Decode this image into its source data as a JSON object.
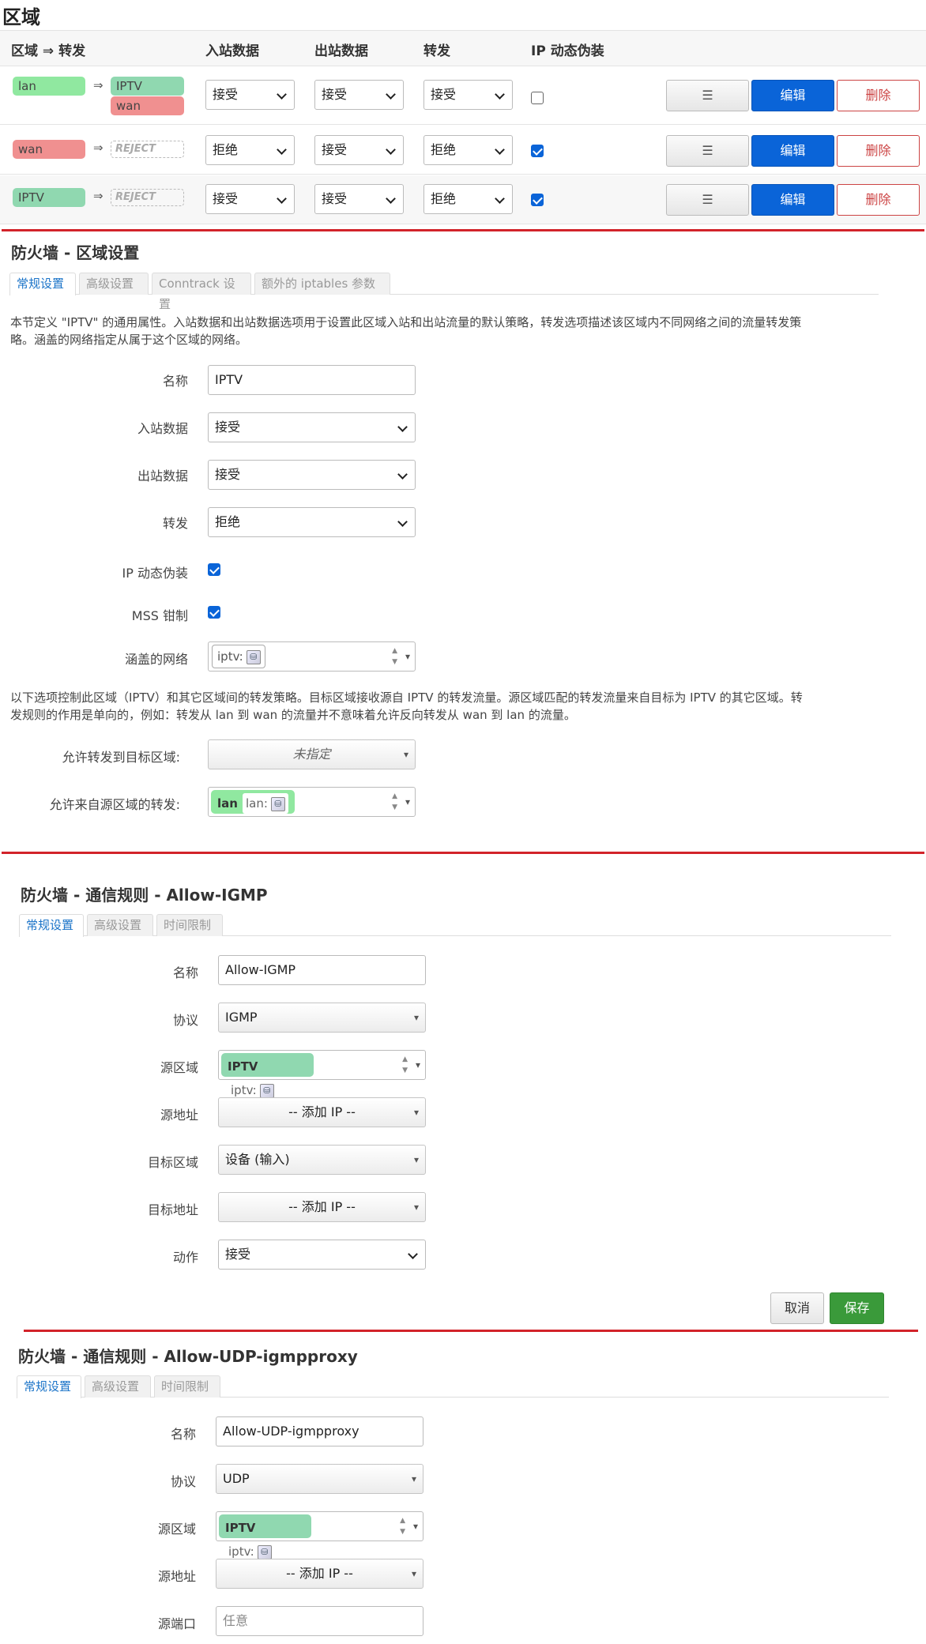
{
  "zones": {
    "title": "区域",
    "headers": {
      "zone_forward": "区域 ⇒ 转发",
      "input": "入站数据",
      "output": "出站数据",
      "forward": "转发",
      "masq": "IP 动态伪装"
    },
    "arrow": "⇒",
    "rows": [
      {
        "zone": "lan",
        "targets": [
          "IPTV",
          "wan"
        ],
        "input": "接受",
        "output": "接受",
        "forward": "接受",
        "masq": false
      },
      {
        "zone": "wan",
        "reject": "REJECT",
        "input": "拒绝",
        "output": "接受",
        "forward": "拒绝",
        "masq": true
      },
      {
        "zone": "IPTV",
        "reject": "REJECT",
        "input": "接受",
        "output": "接受",
        "forward": "拒绝",
        "masq": true
      }
    ],
    "buttons": {
      "menu": "☰",
      "edit": "编辑",
      "delete": "删除"
    }
  },
  "zone_settings": {
    "title": "防火墙 - 区域设置",
    "tabs": [
      "常规设置",
      "高级设置",
      "Conntrack 设置",
      "额外的 iptables 参数"
    ],
    "desc1_line1": "本节定义 \"IPTV\" 的通用属性。入站数据和出站数据选项用于设置此区域入站和出站流量的默认策略，转发选项描述该区域内不同网络之间的流量转发策",
    "desc1_line2": "略。涵盖的网络指定从属于这个区域的网络。",
    "fields": {
      "name_label": "名称",
      "name_value": "IPTV",
      "input_label": "入站数据",
      "input_value": "接受",
      "output_label": "出站数据",
      "output_value": "接受",
      "forward_label": "转发",
      "forward_value": "拒绝",
      "masq_label": "IP 动态伪装",
      "masq": true,
      "mss_label": "MSS 钳制",
      "mss": true,
      "networks_label": "涵盖的网络",
      "network": "iptv:"
    },
    "desc2_line1": "以下选项控制此区域（IPTV）和其它区域间的转发策略。目标区域接收源自 IPTV 的转发流量。源区域匹配的转发流量来自目标为 IPTV 的其它区域。转",
    "desc2_line2": "发规则的作用是单向的，例如：转发从 lan 到 wan 的流量并不意味着允许反向转发从 wan 到 lan 的流量。",
    "allow_to_label": "允许转发到目标区域:",
    "allow_to_value": "未指定",
    "allow_from_label": "允许来自源区域的转发:",
    "allow_from_zone": "lan",
    "allow_from_net": "lan:"
  },
  "rule1": {
    "title": "防火墙 - 通信规则 - Allow-IGMP",
    "tabs": [
      "常规设置",
      "高级设置",
      "时间限制"
    ],
    "name_label": "名称",
    "name_value": "Allow-IGMP",
    "proto_label": "协议",
    "proto_value": "IGMP",
    "src_zone_label": "源区域",
    "src_zone": "IPTV",
    "src_net": "iptv:",
    "src_addr_label": "源地址",
    "src_addr_value": "-- 添加 IP --",
    "dest_zone_label": "目标区域",
    "dest_zone_value": "设备 (输入)",
    "dest_addr_label": "目标地址",
    "dest_addr_value": "-- 添加 IP --",
    "action_label": "动作",
    "action_value": "接受",
    "cancel": "取消",
    "save": "保存"
  },
  "rule2": {
    "title": "防火墙 - 通信规则 - Allow-UDP-igmpproxy",
    "tabs": [
      "常规设置",
      "高级设置",
      "时间限制"
    ],
    "name_label": "名称",
    "name_value": "Allow-UDP-igmpproxy",
    "proto_label": "协议",
    "proto_value": "UDP",
    "src_zone_label": "源区域",
    "src_zone": "IPTV",
    "src_net": "iptv:",
    "src_addr_label": "源地址",
    "src_addr_value": "-- 添加 IP --",
    "src_port_label": "源端口",
    "src_port_placeholder": "任意"
  },
  "colors": {
    "lan": "#90e8a0",
    "wan": "#f09090",
    "iptv": "#90d8b0",
    "edit": "#0a64d8",
    "save": "#3a9a3a",
    "separator": "#d2232a"
  }
}
